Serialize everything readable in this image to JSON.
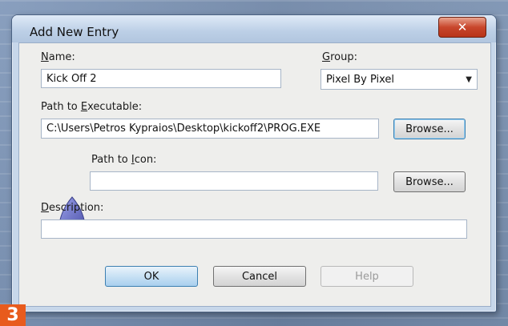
{
  "dialog": {
    "title": "Add New Entry",
    "close_label": "✕"
  },
  "fields": {
    "name_label_prefix": "N",
    "name_label_rest": "ame:",
    "name_value": "Kick Off 2",
    "group_label_prefix": "G",
    "group_label_rest": "roup:",
    "group_value": "Pixel By Pixel",
    "path_label_start": "Path to ",
    "path_label_u": "E",
    "path_label_end": "xecutable:",
    "path_value": "C:\\Users\\Petros Kypraios\\Desktop\\kickoff2\\PROG.EXE",
    "icon_label_start": "Path to ",
    "icon_label_u": "I",
    "icon_label_end": "con:",
    "icon_value": "",
    "desc_label_u": "D",
    "desc_label_rest": "escription:",
    "desc_value": ""
  },
  "buttons": {
    "browse_exe": "Browse...",
    "browse_icon": "Browse...",
    "ok": "OK",
    "cancel": "Cancel",
    "help": "Help"
  },
  "badge": "3",
  "colors": {
    "accent_close": "#c8462c",
    "badge": "#e85b1d",
    "icon_fill": "#6e73c9"
  }
}
